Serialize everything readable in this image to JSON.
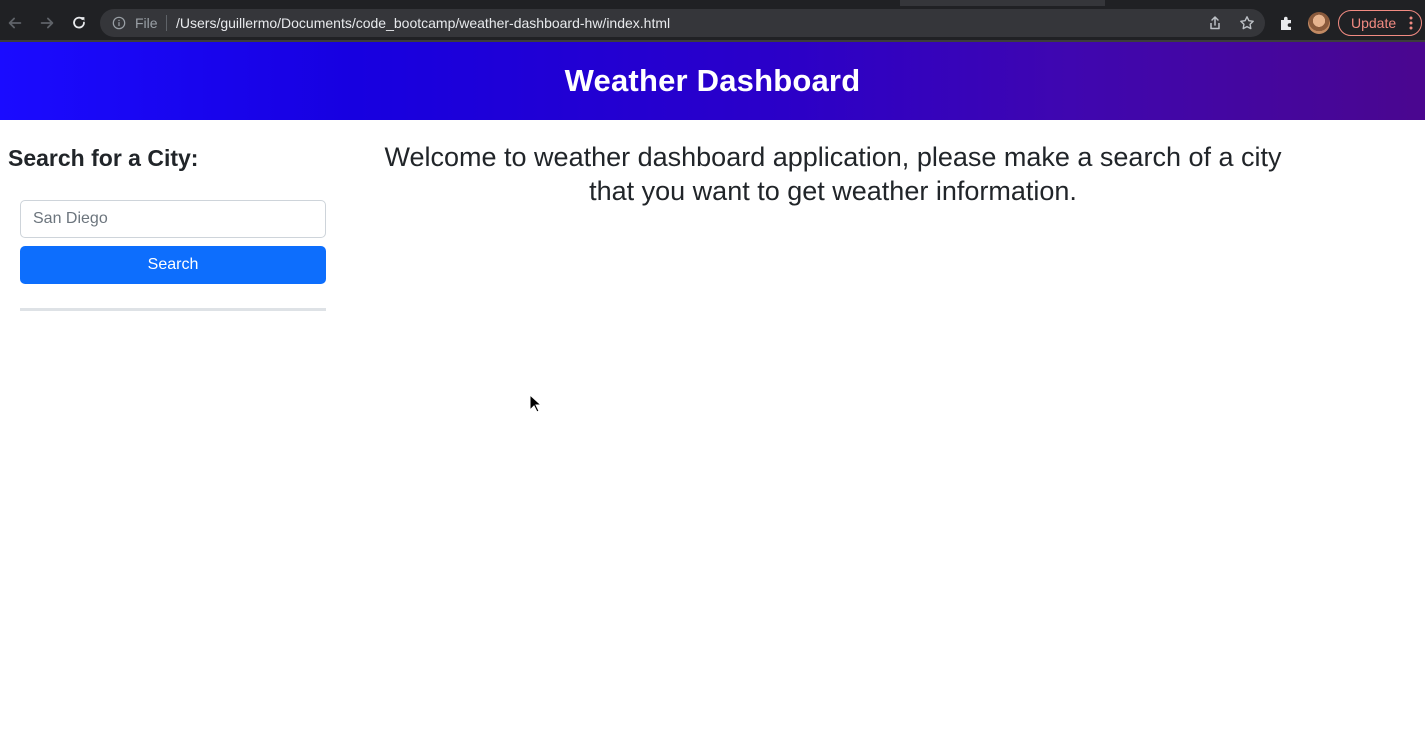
{
  "browser": {
    "scheme_label": "File",
    "url": "/Users/guillermo/Documents/code_bootcamp/weather-dashboard-hw/index.html",
    "update_label": "Update",
    "icons": [
      "back-icon",
      "forward-icon",
      "reload-icon",
      "info-icon",
      "share-icon",
      "star-icon",
      "extensions-icon",
      "profile-avatar",
      "menu-icon"
    ]
  },
  "header": {
    "title": "Weather Dashboard",
    "gradient_colors": [
      "#1a0bff",
      "#4a068f"
    ]
  },
  "sidebar": {
    "heading": "Search for a City:",
    "search_input": {
      "placeholder": "San Diego",
      "value": ""
    },
    "search_button_label": "Search"
  },
  "main": {
    "welcome_message": "Welcome to weather dashboard application, please make a search of a city that you want to get weather information."
  },
  "colors": {
    "primary_button": "#0d6efd",
    "browser_chrome": "#202124",
    "update_accent": "#f28b82"
  }
}
